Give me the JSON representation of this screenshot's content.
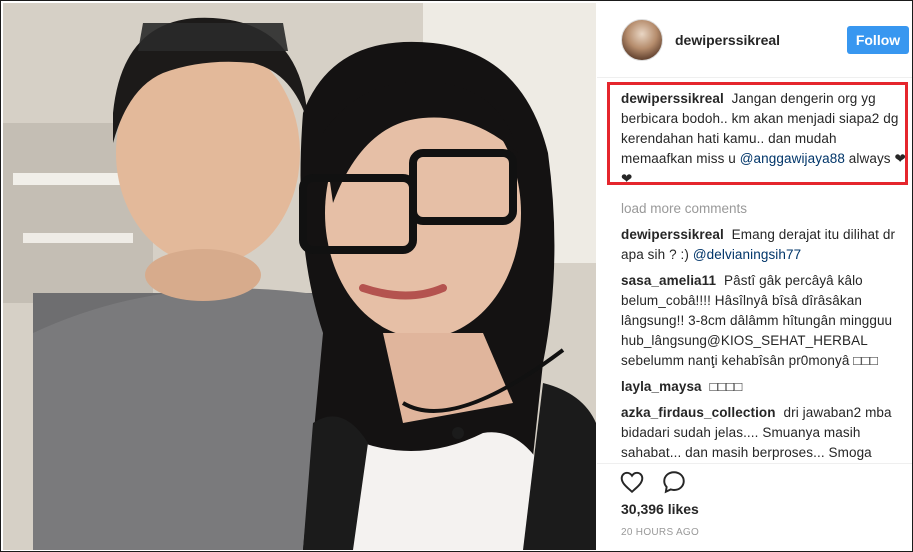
{
  "post": {
    "photo_icon": "photo",
    "username": "dewiperssikreal",
    "follow_label": "Follow",
    "avatar_icon": "avatar",
    "accent_color": "#3897f0",
    "highlight_color": "#e5262d"
  },
  "caption": {
    "author": "dewiperssikreal",
    "text_before": "Jangan dengerin org yg berbicara bodoh.. km akan menjadi siapa2 dg kerendahan hati kamu.. dan mudah memaafkan miss u",
    "mention": "@anggawijaya88",
    "text_after": "always ❤❤"
  },
  "load_more": "load more comments",
  "comments": [
    {
      "author": "dewiperssikreal",
      "text": "Emang derajat itu dilihat dr apa sih ? :)",
      "mention": "@delvianingsih77"
    },
    {
      "author": "sasa_amelia11",
      "text": "Pâstî gâk percâyâ kâlo belum_cobâ!!!! Hâsîlnyâ bîsâ dîrâsâkan lângsung!! 3-8cm dâlâmm hîtungân mingguu hub_lângsung@KIOS_SEHAT_HERBAL sebelumm nanţi kehabîsân pr0monyâ □□□",
      "mention": ""
    },
    {
      "author": "layla_maysa",
      "text": "□□□□",
      "mention": ""
    },
    {
      "author": "azka_firdaus_collection",
      "text": "dri jawaban2 mba bidadari sudah jelas.... Smuanya masih sahabat... dan masih berproses... Smoga",
      "mention": ""
    }
  ],
  "actions": {
    "like_icon": "heart-icon",
    "comment_icon": "comment-icon",
    "likes": "30,396 likes",
    "timestamp": "20 HOURS AGO"
  }
}
